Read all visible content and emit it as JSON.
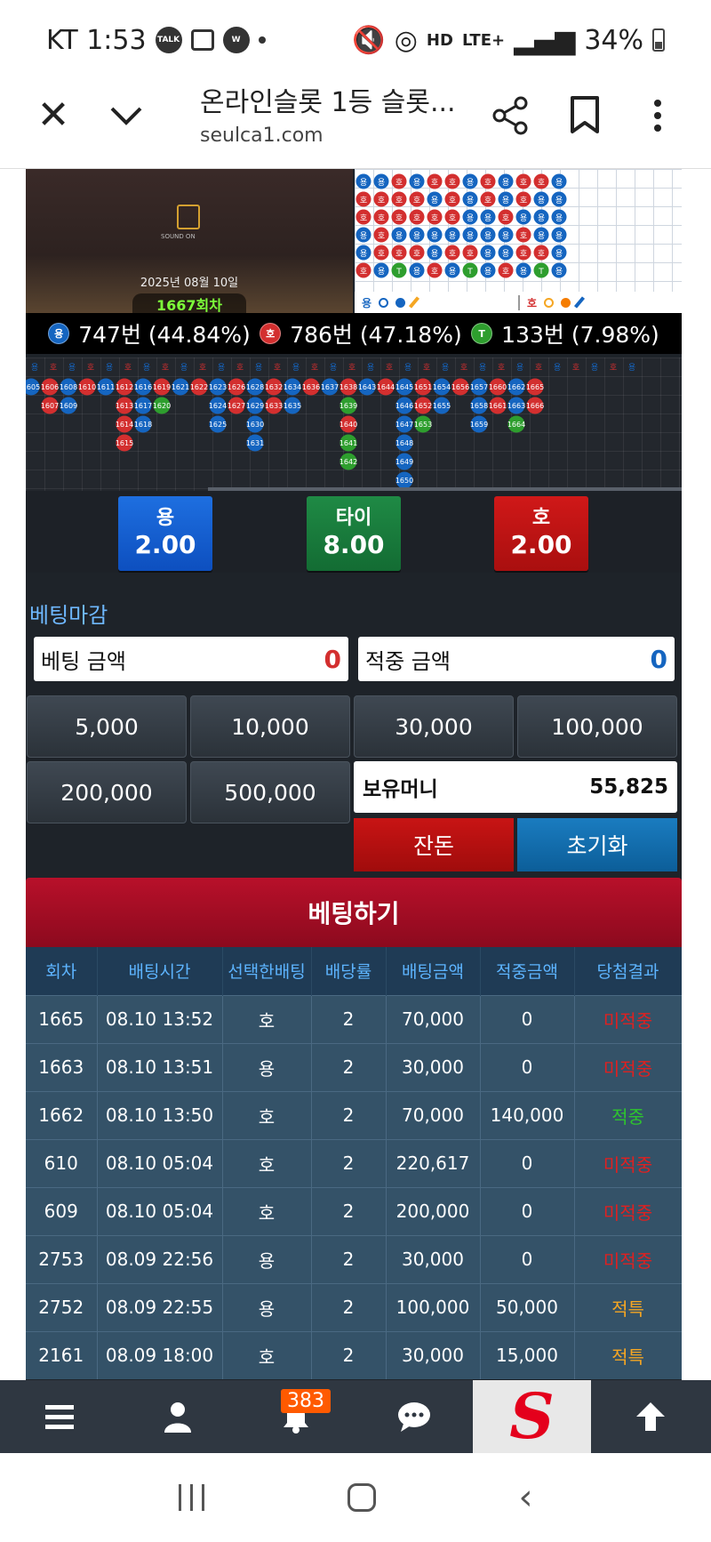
{
  "status_bar": {
    "carrier_time": "KT 1:53",
    "network": "LTE+",
    "battery": "34%",
    "talk_label": "TALK",
    "hd_label": "HD"
  },
  "browser": {
    "title": "온라인슬롯 1등 슬롯...",
    "url": "seulca1.com"
  },
  "video": {
    "date": "2025년 08월 10일",
    "round": "1667회차",
    "sound_label": "SOUND ON"
  },
  "road_legend": {
    "dragon": "용",
    "tiger": "호"
  },
  "stats": {
    "dragon": {
      "chip": "용",
      "text": "747번 (44.84%)"
    },
    "tiger": {
      "chip": "호",
      "text": "786번 (47.18%)"
    },
    "tie": {
      "chip": "T",
      "text": "133번 (7.98%)"
    }
  },
  "bets": {
    "dragon": {
      "label": "용",
      "odds": "2.00"
    },
    "tie": {
      "label": "타이",
      "odds": "8.00"
    },
    "tiger": {
      "label": "호",
      "odds": "2.00"
    }
  },
  "betting_closed": "베팅마감",
  "bet_amount": {
    "label": "베팅 금액",
    "value": "0"
  },
  "win_amount": {
    "label": "적중 금액",
    "value": "0"
  },
  "chips": [
    "5,000",
    "10,000",
    "30,000",
    "100,000",
    "200,000",
    "500,000"
  ],
  "balance": {
    "label": "보유머니",
    "value": "55,825"
  },
  "actions": {
    "change": "잔돈",
    "reset": "초기화"
  },
  "place_bet": "베팅하기",
  "table": {
    "headers": [
      "회차",
      "배팅시간",
      "선택한배팅",
      "배당률",
      "배팅금액",
      "적중금액",
      "당첨결과"
    ],
    "rows": [
      [
        "1665",
        "08.10 13:52",
        "호",
        "2",
        "70,000",
        "0",
        "미적중"
      ],
      [
        "1663",
        "08.10 13:51",
        "용",
        "2",
        "30,000",
        "0",
        "미적중"
      ],
      [
        "1662",
        "08.10 13:50",
        "호",
        "2",
        "70,000",
        "140,000",
        "적중"
      ],
      [
        "610",
        "08.10 05:04",
        "호",
        "2",
        "220,617",
        "0",
        "미적중"
      ],
      [
        "609",
        "08.10 05:04",
        "호",
        "2",
        "200,000",
        "0",
        "미적중"
      ],
      [
        "2753",
        "08.09 22:56",
        "용",
        "2",
        "30,000",
        "0",
        "미적중"
      ],
      [
        "2752",
        "08.09 22:55",
        "용",
        "2",
        "100,000",
        "50,000",
        "적특"
      ],
      [
        "2161",
        "08.09 18:00",
        "호",
        "2",
        "30,000",
        "15,000",
        "적특"
      ]
    ]
  },
  "nav": {
    "badge": "383"
  },
  "colors": {
    "dragon": "#1565c0",
    "tiger": "#d32f2f",
    "tie": "#2e9e2e",
    "accent": "#b8102a"
  },
  "road_grid": [
    "DDTDTTDTDTTD",
    "TTTTDTDTDTDD",
    "TTTTTTDDTDDD",
    "DTDDDDDDDTDD",
    "DTTTDTTDDTTD",
    "TDGDTDGDTDGD"
  ],
  "history_columns": [
    [
      "1605"
    ],
    [
      "1606",
      "1607"
    ],
    [
      "1608",
      "1609"
    ],
    [
      "1610"
    ],
    [
      "1611"
    ],
    [
      "1612",
      "1613",
      "1614",
      "1615"
    ],
    [
      "1616",
      "1617",
      "1618"
    ],
    [
      "1619",
      "1620"
    ],
    [
      "1621"
    ],
    [
      "1622"
    ],
    [
      "1623",
      "1624",
      "1625"
    ],
    [
      "1626",
      "1627"
    ],
    [
      "1628",
      "1629",
      "1630",
      "1631"
    ],
    [
      "1632",
      "1633"
    ],
    [
      "1634",
      "1635"
    ],
    [
      "1636"
    ],
    [
      "1637"
    ],
    [
      "1638",
      "1639",
      "1640",
      "1641",
      "1642"
    ],
    [
      "1643"
    ],
    [
      "1644"
    ],
    [
      "1645",
      "1646",
      "1647",
      "1648",
      "1649",
      "1650"
    ],
    [
      "1651",
      "1652",
      "1653"
    ],
    [
      "1654",
      "1655"
    ],
    [
      "1656"
    ],
    [
      "1657",
      "1658",
      "1659"
    ],
    [
      "1660",
      "1661"
    ],
    [
      "1662",
      "1663",
      "1664"
    ],
    [
      "1665",
      "1666"
    ]
  ]
}
